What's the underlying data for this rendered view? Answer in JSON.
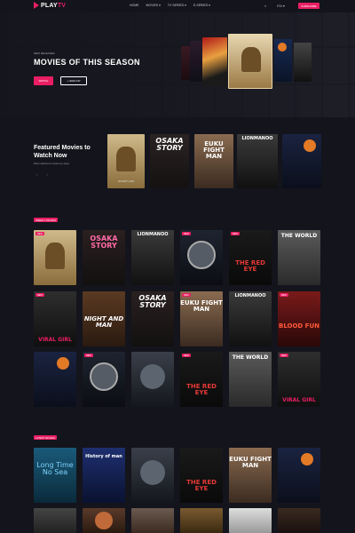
{
  "nav": {
    "logo_main": "PLAY",
    "logo_accent": "TV",
    "menu": [
      "HOME",
      "MOVIES ▾",
      "TV SERIES ▾",
      "E-SERIES ▾"
    ],
    "icon_search": "⌕",
    "icon_lang": "EN ▾",
    "subscribe": "SUBSCRIBE"
  },
  "hero": {
    "kicker": "NEW RELEASES",
    "title": "MOVIES OF THIS SEASON",
    "primary_btn": "WATCH",
    "secondary_btn": "+ SIGN UP"
  },
  "featured": {
    "title": "Featured Movies to Watch Now",
    "subtitle": "Most watched movies by days",
    "prev": "‹",
    "next": "›"
  },
  "sections": {
    "weekly": "WEEKLY MOVIES",
    "latest": "LATEST MOVIES"
  },
  "posters": {
    "osaka": "OSAKA STORY",
    "euku": "EUKU FIGHT MAN",
    "lion": "LIONMANOO",
    "redeye": "THE RED EYE",
    "world": "THE WORLD",
    "nightman": "NIGHT AND MAN",
    "bloodfun": "BLOOD FUN",
    "viral": "VIRAL GIRL",
    "longtime": "Long Time No Sea",
    "history": "History of man",
    "new_badge": "NEW",
    "book_title": "ANCIENT LAND"
  },
  "colors": {
    "accent": "#e91e63",
    "background": "#14141c"
  }
}
